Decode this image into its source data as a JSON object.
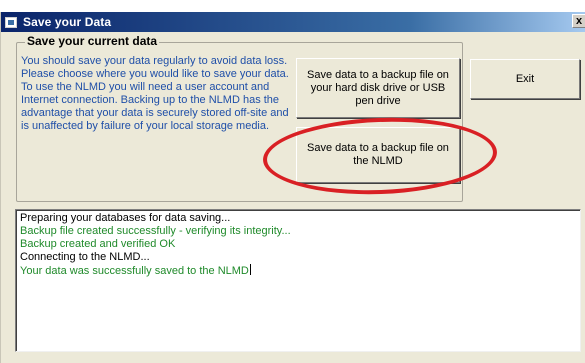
{
  "window": {
    "title": "Save your Data",
    "close_glyph": "x"
  },
  "group": {
    "title": "Save your current data",
    "paragraphs": [
      "You should save your data regularly to avoid data loss.",
      "Please choose where you would like to save your data.",
      "To use the NLMD you will need a user account and Internet connection. Backing up to the NLMD has the advantage that your data is securely stored off-site and is unaffected by failure of your local storage media."
    ]
  },
  "buttons": {
    "hdd_label": "Save data to a backup file on your hard disk drive or USB pen drive",
    "nlmd_label": "Save data to a backup file on the NLMD",
    "exit_label": "Exit"
  },
  "log": {
    "lines": [
      {
        "text": "Preparing your databases for data saving...",
        "color": "#000000"
      },
      {
        "text": "Backup file created successfully - verifying its integrity...",
        "color": "#1f8a2a"
      },
      {
        "text": "Backup created and verified OK",
        "color": "#1f8a2a"
      },
      {
        "text": "Connecting to the NLMD...",
        "color": "#000000"
      },
      {
        "text": "Your data was successfully saved to the NLMD",
        "color": "#1f8a2a"
      }
    ]
  },
  "colors": {
    "info_text": "#1f4fa8",
    "highlight_ring": "#d92024",
    "titlebar": "#0a246a"
  },
  "icons": [
    "app-icon",
    "close-icon"
  ]
}
